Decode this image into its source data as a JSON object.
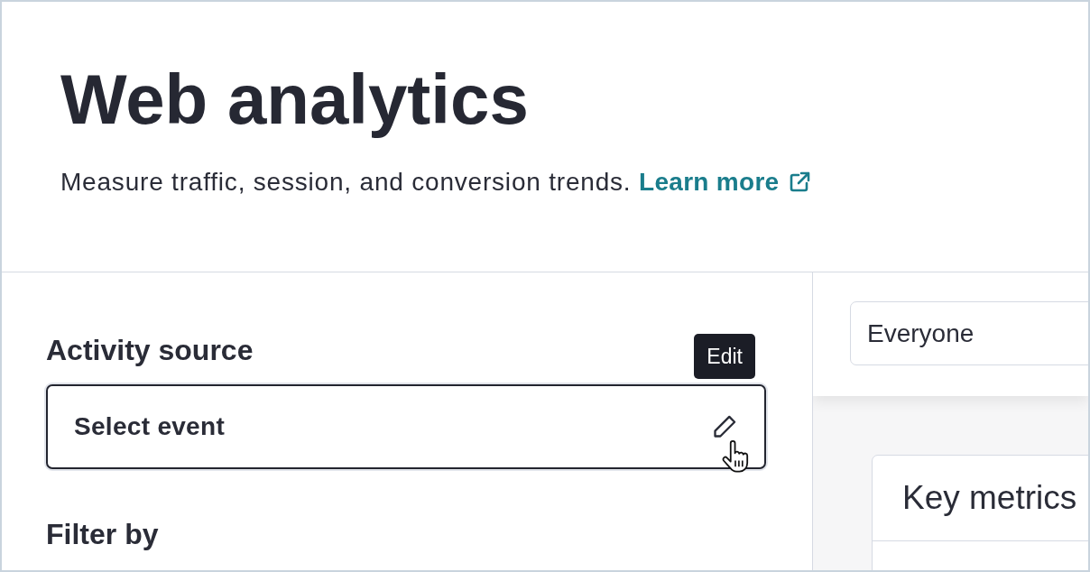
{
  "header": {
    "title": "Web analytics",
    "description": "Measure traffic, session, and conversion trends.",
    "link": {
      "label": "Learn more"
    }
  },
  "left_panel": {
    "sections": [
      {
        "kind": "selector",
        "label": "Activity source",
        "tooltip": "Edit",
        "button_label": "Select event"
      },
      {
        "kind": "heading",
        "label": "Filter by"
      }
    ]
  },
  "right_panel": {
    "audience_field": {
      "value": "Everyone"
    },
    "card": {
      "title": "Key metrics"
    }
  }
}
